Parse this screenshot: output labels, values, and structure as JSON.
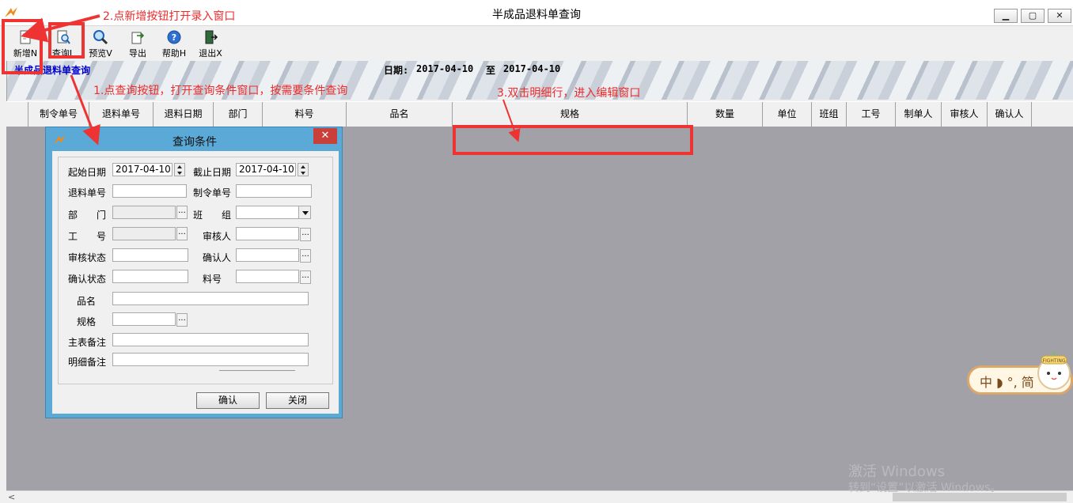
{
  "window": {
    "title": "半成品退料单查询"
  },
  "toolbar": {
    "buttons": [
      {
        "label": "新增N",
        "icon": "new-icon"
      },
      {
        "label": "查询L",
        "icon": "query-icon"
      },
      {
        "label": "预览V",
        "icon": "preview-icon"
      },
      {
        "label": "导出",
        "icon": "export-icon"
      },
      {
        "label": "帮助H",
        "icon": "help-icon"
      },
      {
        "label": "退出X",
        "icon": "exit-icon"
      }
    ]
  },
  "banner": {
    "title": "半成品退料单查询",
    "date_label": "日期:",
    "date_start": "2017-04-10",
    "date_to": "至",
    "date_end": "2017-04-10"
  },
  "grid": {
    "columns": [
      "制令单号",
      "退料单号",
      "退料日期",
      "部门",
      "料号",
      "品名",
      "规格",
      "数量",
      "单位",
      "班组",
      "工号",
      "制单人",
      "审核人",
      "确认人"
    ]
  },
  "annotations": {
    "step1": "1.点查询按钮，打开查询条件窗口，按需要条件查询",
    "step2": "2.点新增按钮打开录入窗口",
    "step3": "3.双击明细行，进入编辑窗口"
  },
  "dialog": {
    "title": "查询条件",
    "close": "✕",
    "fields": {
      "start_date_label": "起始日期",
      "start_date_value": "2017-04-10",
      "end_date_label": "截止日期",
      "end_date_value": "2017-04-10",
      "return_no_label": "退料单号",
      "order_no_label": "制令单号",
      "dept_label": "部　　门",
      "team_label": "班　　组",
      "worker_label": "工　　号",
      "auditor_label": "审核人",
      "audit_status_label": "审核状态",
      "confirmer_label": "确认人",
      "confirm_status_label": "确认状态",
      "part_no_label": "料号",
      "product_name_label": "品名",
      "spec_label": "规格",
      "main_note_label": "主表备注",
      "detail_note_label": "明细备注"
    },
    "ok_label": "确认",
    "close_label": "关闭"
  },
  "ime": {
    "text": "中 ◗ °, 简",
    "badge": "FIGHTING"
  },
  "watermark": {
    "line1": "激活 Windows",
    "line2": "转到“设置”以激活 Windows。"
  },
  "colors": {
    "annotation": "#ee3333",
    "grid_bg": "#a1a1a7",
    "dialog_frame": "#5aa9d6"
  }
}
